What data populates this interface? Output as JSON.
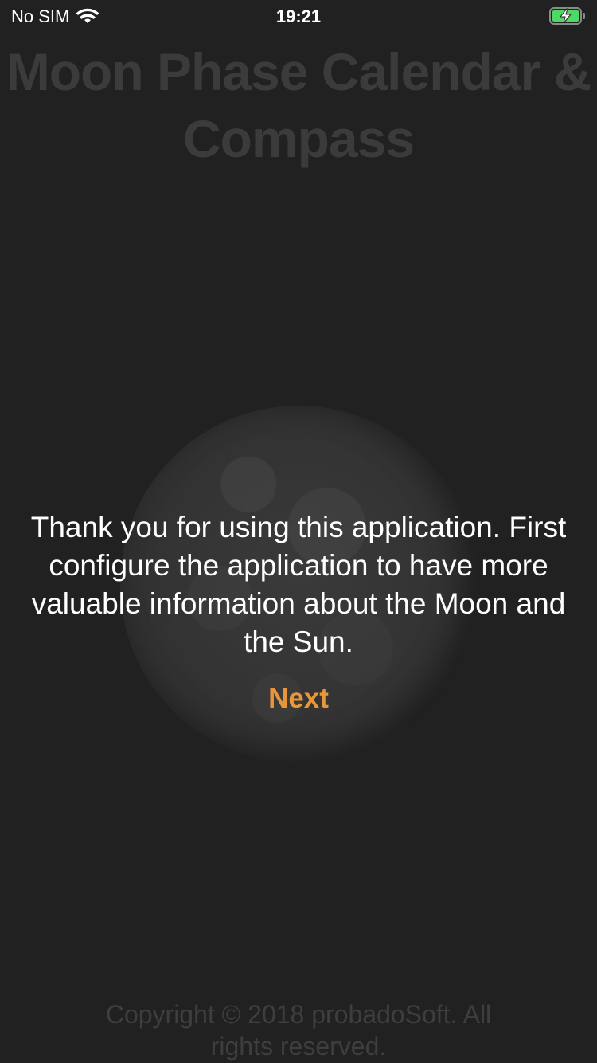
{
  "status_bar": {
    "carrier": "No SIM",
    "time": "19:21",
    "wifi_icon": "wifi-icon",
    "battery_icon": "battery-charging-icon",
    "battery_color": "#4cd964"
  },
  "header": {
    "title": "Moon Phase Calendar & Compass"
  },
  "main": {
    "moon_image": "full-moon-image",
    "message": "Thank you for using this application. First configure the application to have more valuable information about the Moon and the Sun.",
    "next_label": "Next",
    "accent_color": "#e8963a"
  },
  "footer": {
    "copyright": "Copyright © 2018 probadoSoft. All rights reserved."
  }
}
